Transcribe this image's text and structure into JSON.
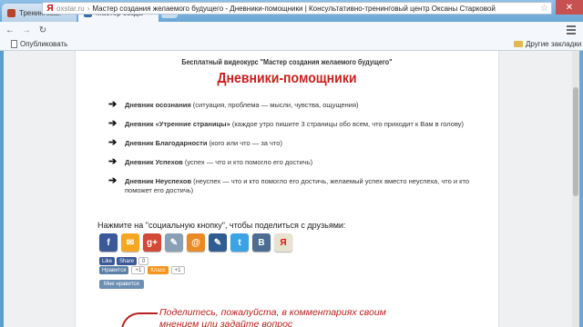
{
  "browser": {
    "tabs": [
      {
        "label": "Тренинговая площадка"
      },
      {
        "label": "Мастер создания желаемого будущего"
      }
    ],
    "address_domain": "oxstar.ru",
    "address_title": "Мастер создания желаемого будущего - Дневники-помощники | Консультативно-тренинговый центр Оксаны Старковой",
    "address_sep": "›",
    "bookmarks": {
      "publish": "Опубликовать",
      "other": "Другие закладки"
    }
  },
  "page": {
    "subtitle": "Бесплатный видеокурс \"Мастер создания желаемого будущего\"",
    "heading": "Дневники-помощники",
    "arrow_glyph": "➔",
    "diaries": [
      {
        "name": "Дневник осознания",
        "desc": " (ситуация, проблема — мысли, чувства, ощущения)"
      },
      {
        "name": "Дневник «Утренние страницы»",
        "desc": " (каждое утро пишите 3 страницы обо всем, что приходит к Вам в голову)"
      },
      {
        "name": "Дневник Благодарности",
        "desc": " (кого или что — за что)"
      },
      {
        "name": "Дневник Успехов",
        "desc": " (успех — что и кто помогло его достичь)"
      },
      {
        "name": "Дневник Неуспехов",
        "desc": " (неуспех — что и кто помогло его достичь, желаемый успех вместо неуспеха, что и кто поможет его достичь)"
      }
    ],
    "share_label": "Нажмите на \"социальную кнопку\", чтобы поделиться с друзьями:",
    "social_icons": [
      {
        "name": "facebook",
        "glyph": "f",
        "color": "#3b5998"
      },
      {
        "name": "moimir",
        "glyph": "✉",
        "color": "#f5a623"
      },
      {
        "name": "googleplus",
        "glyph": "g+",
        "color": "#d34836"
      },
      {
        "name": "bookmark",
        "glyph": "✎",
        "color": "#8aa0b4"
      },
      {
        "name": "mailru",
        "glyph": "@",
        "color": "#e98b24"
      },
      {
        "name": "livejournal",
        "glyph": "✎",
        "color": "#2f5d8f"
      },
      {
        "name": "twitter",
        "glyph": "t",
        "color": "#3aa3e3"
      },
      {
        "name": "vkontakte",
        "glyph": "В",
        "color": "#4c6c91"
      },
      {
        "name": "yandex",
        "glyph": "Я",
        "color": "#e8e2d0"
      }
    ],
    "fb_widget": {
      "like": "Like",
      "share": "Share",
      "count": "0"
    },
    "vk_widget": {
      "like": "Нравится",
      "like_count": "+1",
      "ok": "Класс",
      "ok_count": "+1"
    },
    "vk_like_button": "Мне нравится",
    "comment_note_1": "Поделитесь, пожалуйста, в комментариях своим",
    "comment_note_2": "мнением или задайте вопрос"
  }
}
